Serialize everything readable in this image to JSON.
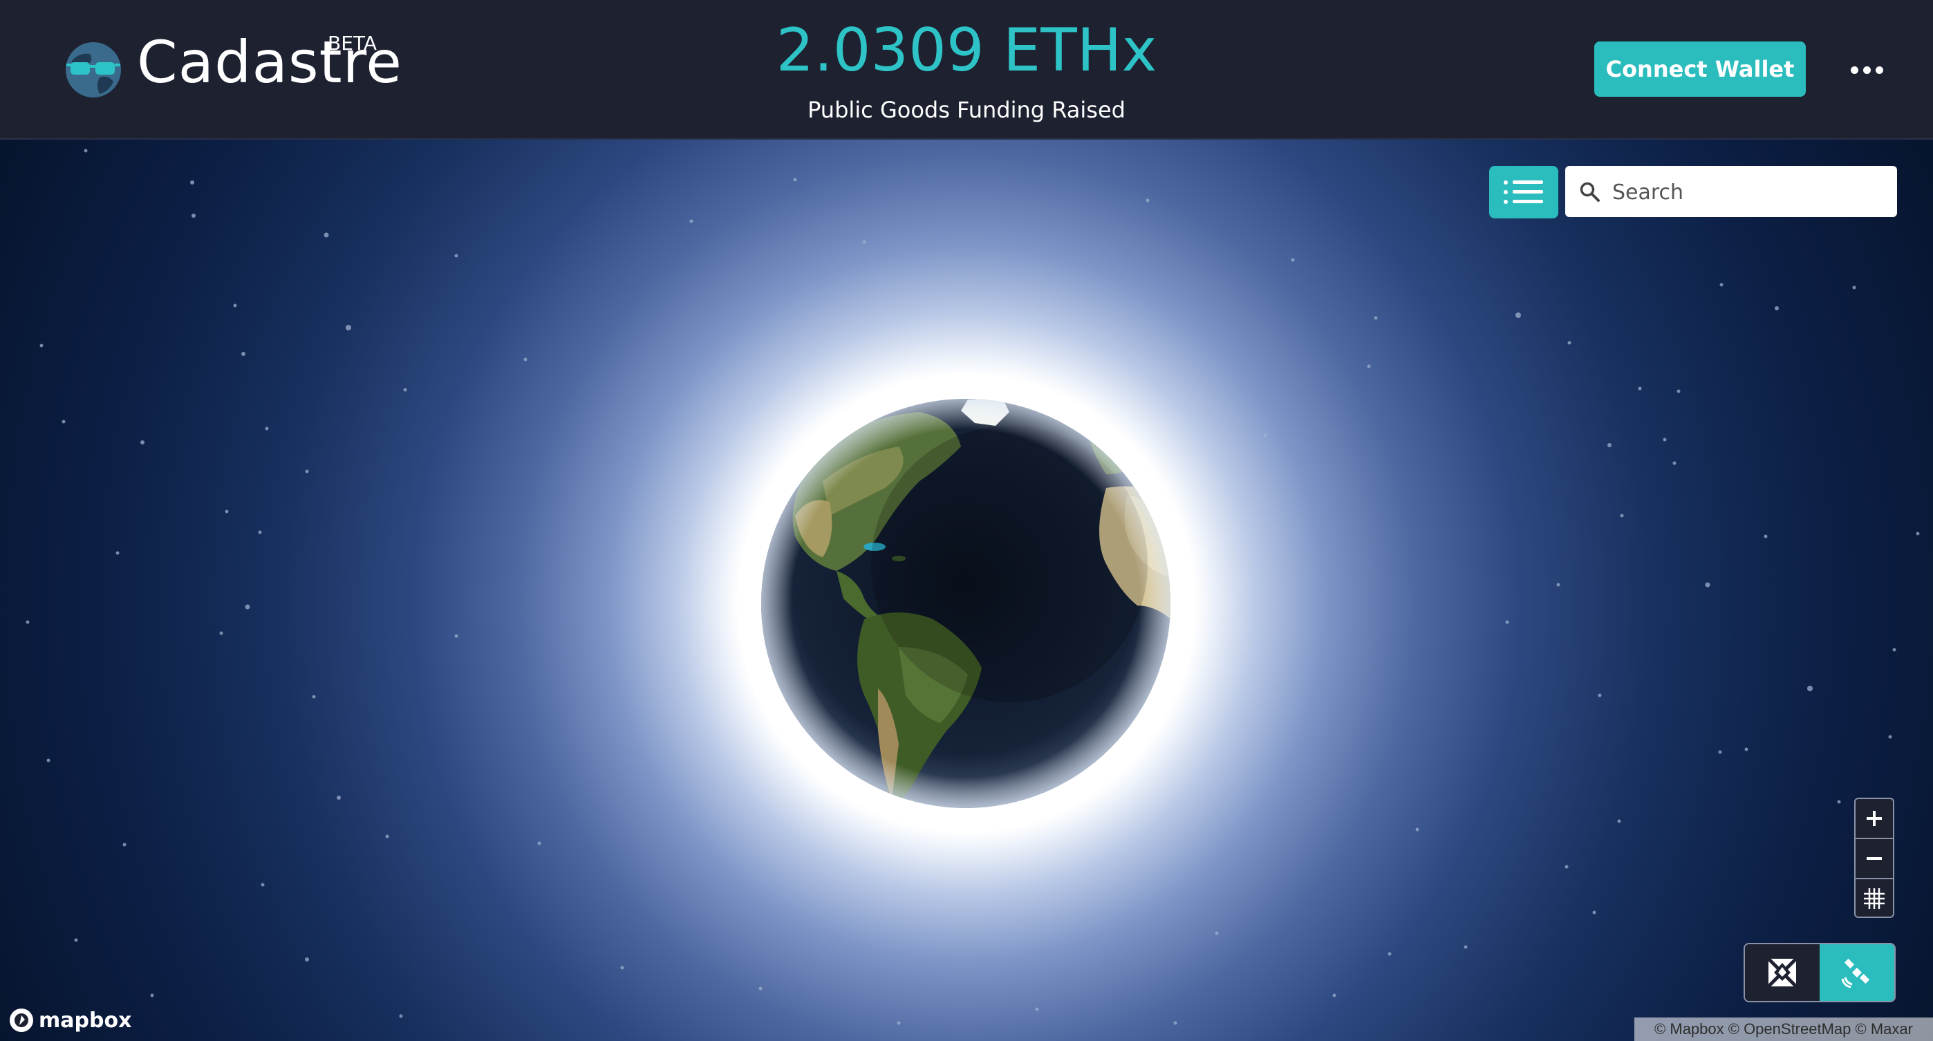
{
  "header": {
    "app_name": "Cadastre",
    "badge": "BETA",
    "funding_amount": "2.0309 ETHx",
    "funding_label": "Public Goods Funding Raised",
    "connect_wallet_label": "Connect Wallet",
    "more_icon": "more-horizontal-icon",
    "logo_icon": "globe-sunglasses-logo"
  },
  "map": {
    "list_toggle_icon": "list-icon",
    "search": {
      "placeholder": "Search",
      "value": "",
      "icon": "search-icon"
    },
    "zoom_controls": [
      {
        "name": "zoom-in",
        "icon": "plus-icon"
      },
      {
        "name": "zoom-out",
        "icon": "minus-icon"
      },
      {
        "name": "grid",
        "icon": "grid-icon"
      }
    ],
    "style_toggle": [
      {
        "name": "map-style",
        "icon": "map-icon",
        "active": false
      },
      {
        "name": "satellite-style",
        "icon": "satellite-icon",
        "active": true
      }
    ],
    "logo_text": "mapbox",
    "attribution": "© Mapbox © OpenStreetMap © Maxar"
  },
  "colors": {
    "accent": "#2bbcbd",
    "header_bg": "#1d2130",
    "space_bg": "#061229",
    "text_primary": "#ffffff"
  }
}
